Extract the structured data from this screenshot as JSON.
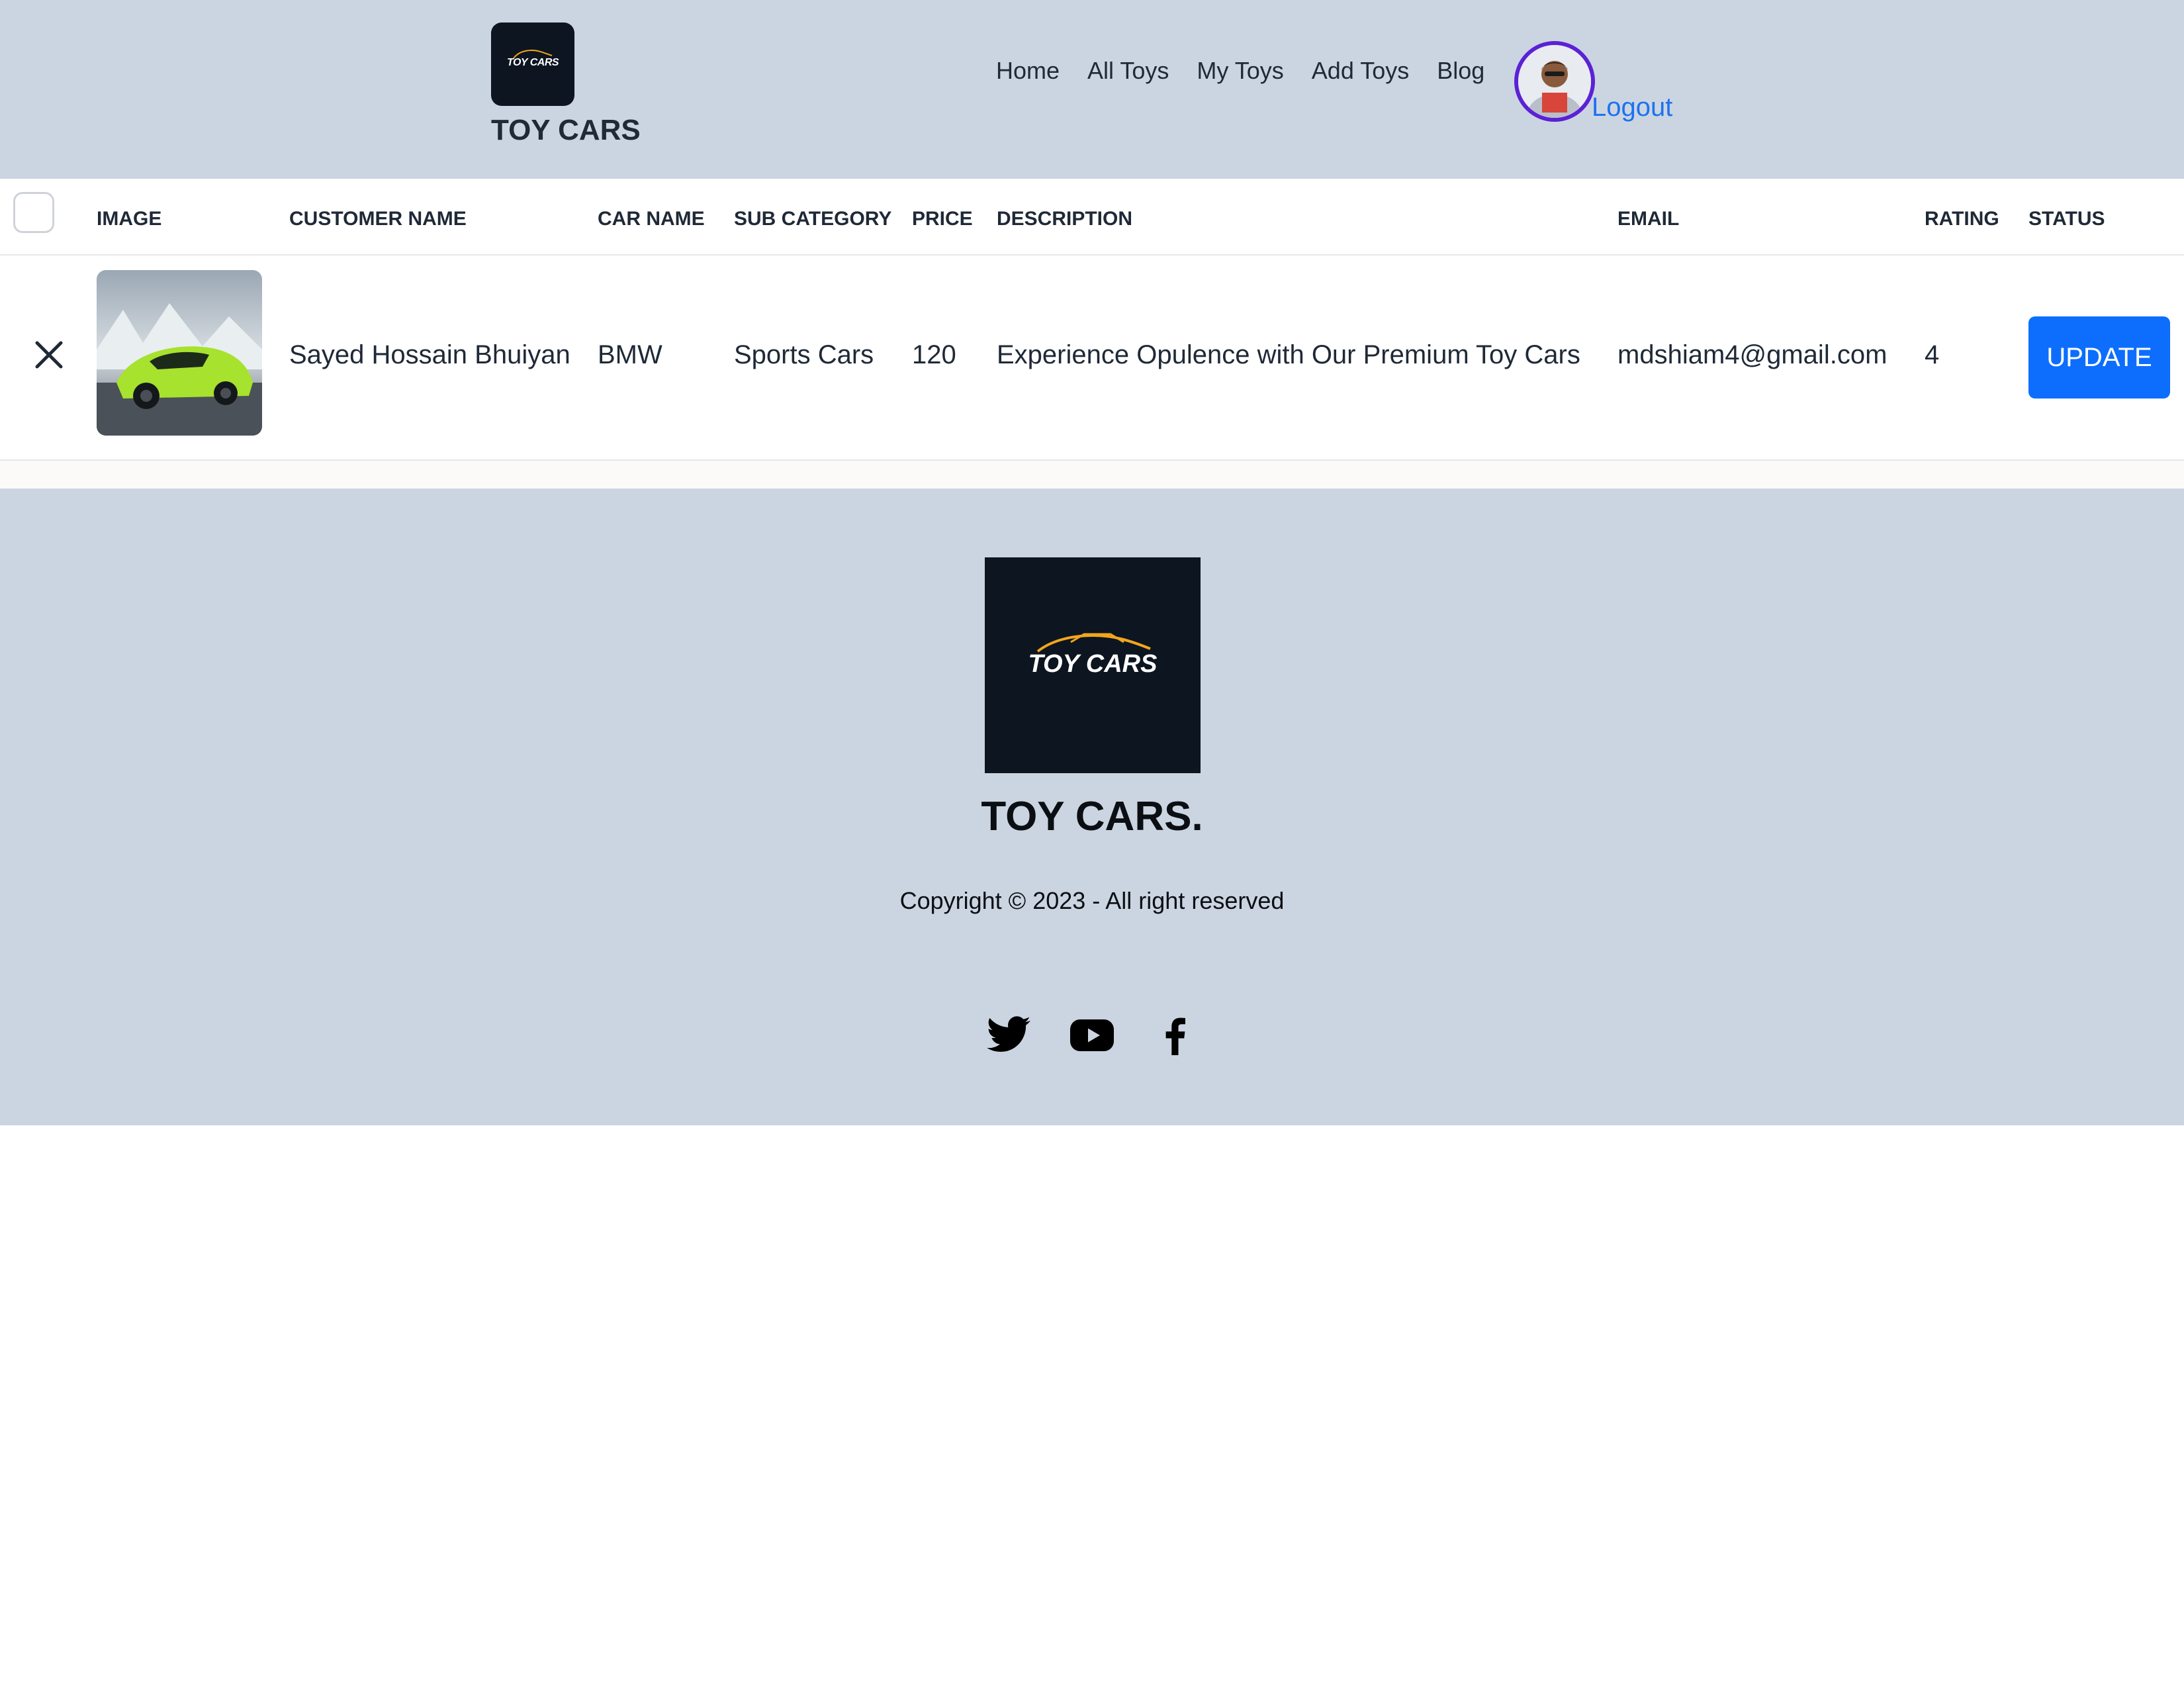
{
  "navbar": {
    "logo_text": "TOY CARS",
    "brand": "TOY CARS",
    "links": [
      "Home",
      "All Toys",
      "My Toys",
      "Add Toys",
      "Blog"
    ],
    "logout": "Logout",
    "avatar_icon": "user-avatar"
  },
  "table": {
    "headers": [
      "IMAGE",
      "CUSTOMER NAME",
      "CAR NAME",
      "SUB CATEGORY",
      "PRICE",
      "DESCRIPTION",
      "EMAIL",
      "RATING",
      "STATUS"
    ],
    "rows": [
      {
        "image_icon": "car-thumbnail",
        "customer_name": "Sayed Hossain Bhuiyan",
        "car_name": "BMW",
        "sub_category": "Sports Cars",
        "price": "120",
        "description": "Experience Opulence with Our Premium Toy Cars",
        "email": "mdshiam4@gmail.com",
        "rating": "4",
        "status_button": "UPDATE"
      }
    ]
  },
  "footer": {
    "logo_text": "TOY CARS",
    "brand": "TOY CARS.",
    "copyright": "Copyright © 2023 - All right reserved",
    "social_icons": [
      "twitter-icon",
      "youtube-icon",
      "facebook-icon"
    ]
  },
  "colors": {
    "nav_bg": "#cbd5e1",
    "logo_bg": "#0d1520",
    "accent_blue": "#0d6efd",
    "avatar_ring": "#5b21d6"
  }
}
